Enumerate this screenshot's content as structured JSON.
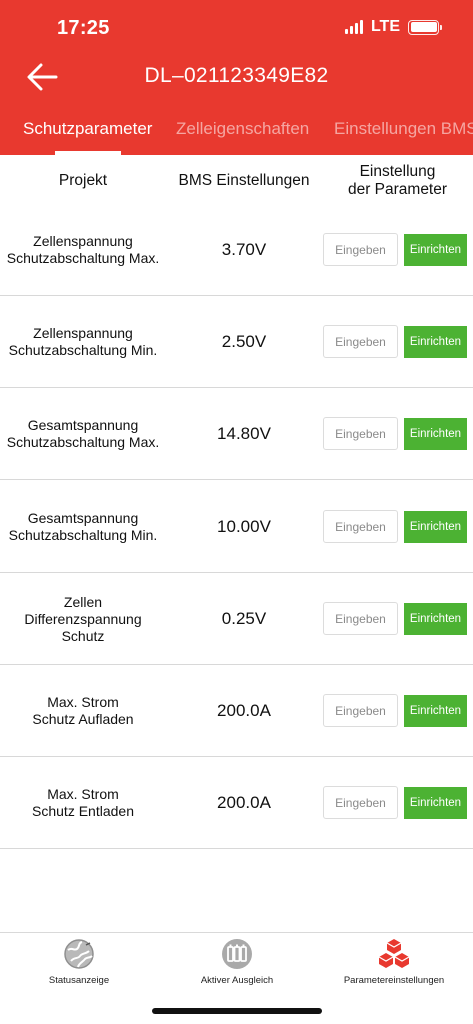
{
  "status_bar": {
    "time": "17:25",
    "network": "LTE"
  },
  "header": {
    "title": "DL–021123349E82",
    "back_icon": "arrow-left-icon"
  },
  "tabs": [
    {
      "label": "Schutzparameter",
      "active": true
    },
    {
      "label": "Zelleigenschaften",
      "active": false
    },
    {
      "label": "Einstellungen BMS",
      "active": false
    }
  ],
  "table": {
    "headers": {
      "project": "Projekt",
      "bms": "BMS Einstellungen",
      "setting": "Einstellung\nder Parameter"
    },
    "input_label": "Eingeben",
    "set_label": "Einrichten",
    "rows": [
      {
        "label": "Zellenspannung\nSchutzabschaltung Max.",
        "value": "3.70V"
      },
      {
        "label": "Zellenspannung\nSchutzabschaltung Min.",
        "value": "2.50V"
      },
      {
        "label": "Gesamtspannung\nSchutzabschaltung Max.",
        "value": "14.80V"
      },
      {
        "label": "Gesamtspannung\nSchutzabschaltung Min.",
        "value": "10.00V"
      },
      {
        "label": "Zellen\nDifferenzspannung\nSchutz",
        "value": "0.25V"
      },
      {
        "label": "Max. Strom\nSchutz Aufladen",
        "value": "200.0A"
      },
      {
        "label": "Max. Strom\nSchutz Entladen",
        "value": "200.0A"
      }
    ]
  },
  "bottom_nav": [
    {
      "label": "Statusanzeige",
      "icon": "globe-icon"
    },
    {
      "label": "Aktiver Ausgleich",
      "icon": "battery-cells-icon"
    },
    {
      "label": "Parametereinstellungen",
      "icon": "cubes-icon"
    }
  ],
  "colors": {
    "brand_red": "#e8392f",
    "action_green": "#4cb233"
  }
}
